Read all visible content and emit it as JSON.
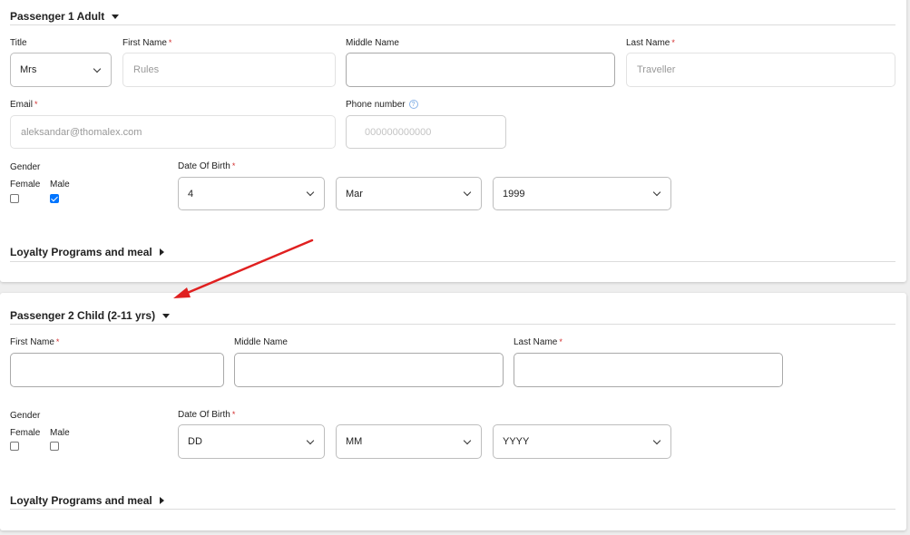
{
  "passenger1": {
    "header": "Passenger 1 Adult",
    "title_label": "Title",
    "title_value": "Mrs",
    "first_name_label": "First Name",
    "first_name_placeholder": "Rules",
    "middle_name_label": "Middle Name",
    "middle_name_value": "",
    "last_name_label": "Last Name",
    "last_name_placeholder": "Traveller",
    "email_label": "Email",
    "email_placeholder": "aleksandar@thomalex.com",
    "phone_label": "Phone number",
    "phone_help": "?",
    "phone_placeholder": "000000000000",
    "gender_label": "Gender",
    "female_label": "Female",
    "male_label": "Male",
    "female_checked": false,
    "male_checked": true,
    "dob_label": "Date Of Birth",
    "dob_day": "4",
    "dob_month": "Mar",
    "dob_year": "1999",
    "loyalty": "Loyalty Programs and meal"
  },
  "passenger2": {
    "header": "Passenger 2 Child (2-11 yrs)",
    "first_name_label": "First Name",
    "middle_name_label": "Middle Name",
    "last_name_label": "Last Name",
    "gender_label": "Gender",
    "female_label": "Female",
    "male_label": "Male",
    "female_checked": false,
    "male_checked": false,
    "dob_label": "Date Of Birth",
    "dob_day": "DD",
    "dob_month": "MM",
    "dob_year": "YYYY",
    "loyalty": "Loyalty Programs and meal"
  },
  "required_mark": "*",
  "colors": {
    "required": "#d32f2f",
    "checkbox_checked": "#0075ff",
    "annotation_arrow": "#e02020"
  }
}
